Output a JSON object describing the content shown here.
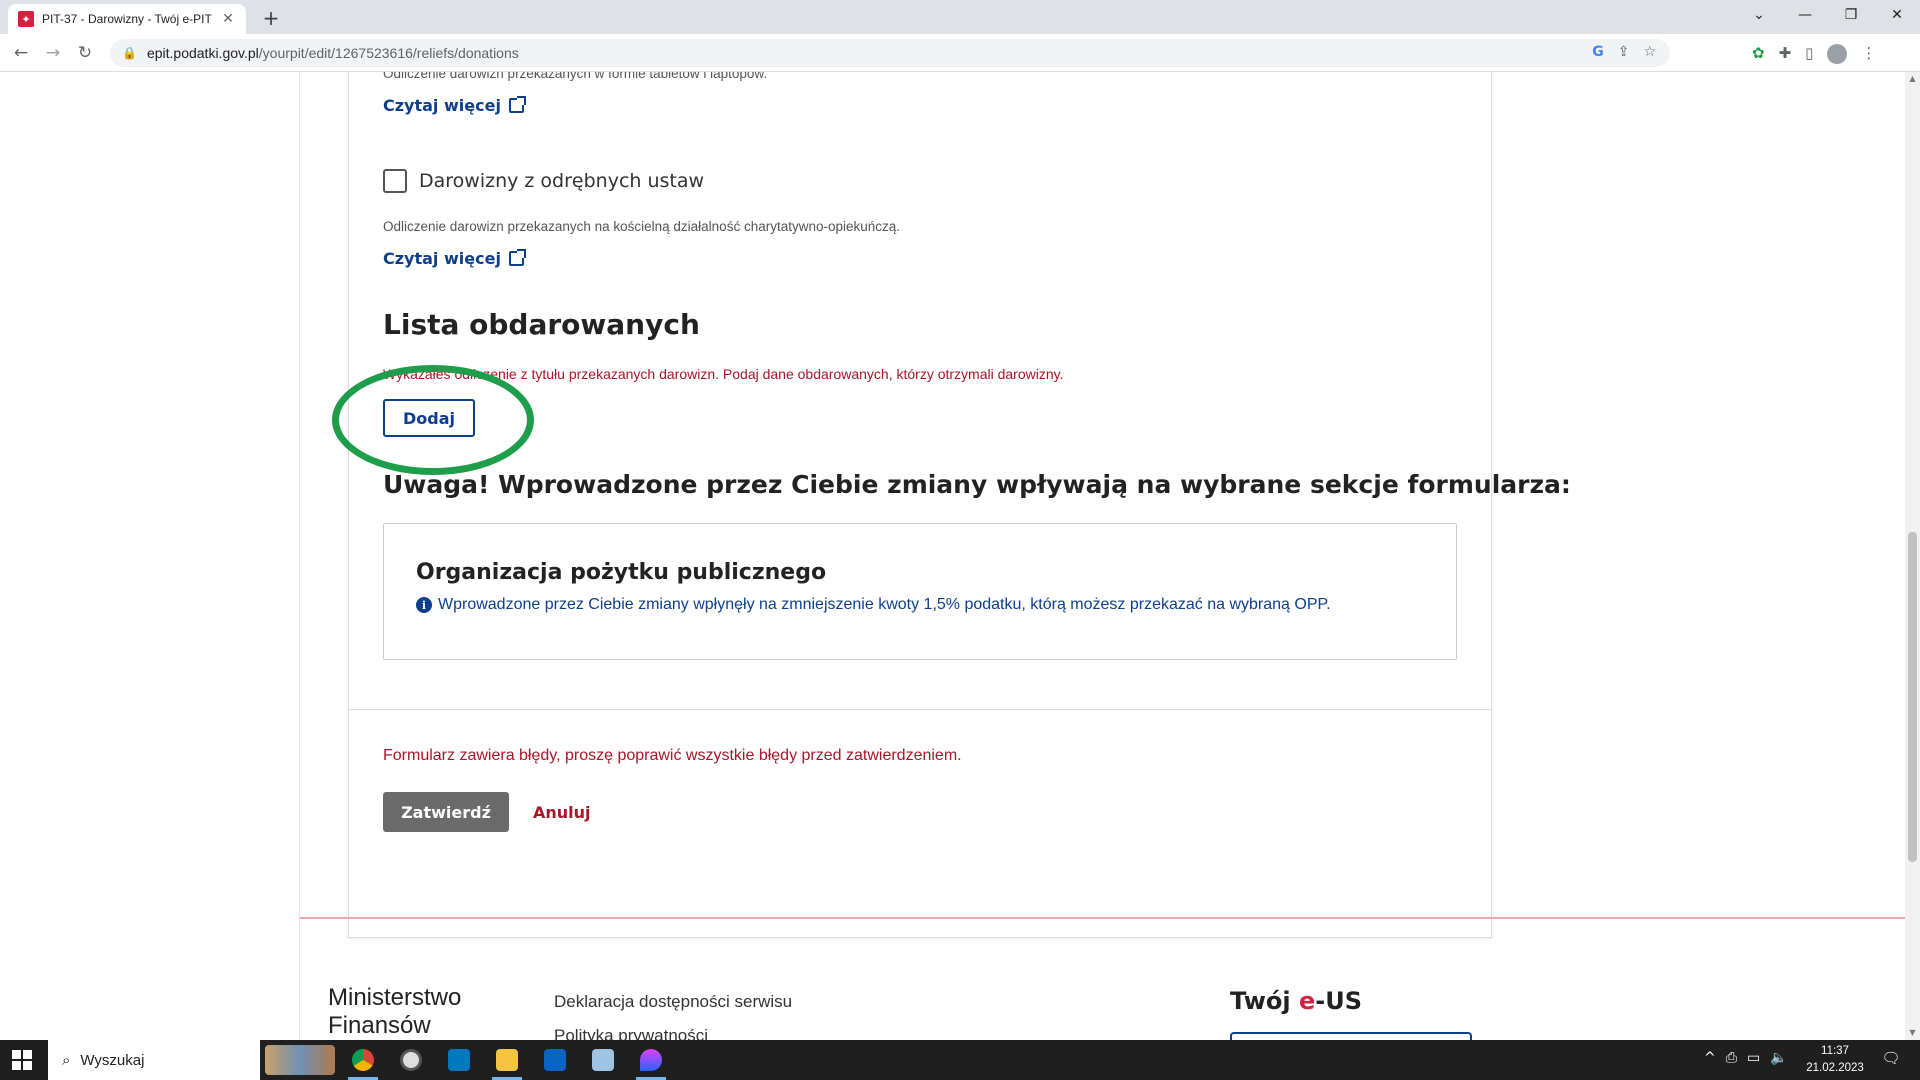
{
  "browser": {
    "tab_title": "PIT-37 - Darowizny - Twój e-PIT",
    "favicon_letter": "🛡",
    "new_tab": "+",
    "url_host": "epit.podatki.gov.pl",
    "url_path": "/yourpit/edit/1267523616/reliefs/donations"
  },
  "page": {
    "prev_description": "Odliczenie darowizn przekazanych w formie tabletów i laptopów.",
    "read_more_1": "Czytaj więcej",
    "checkbox_label": "Darowizny z odrębnych ustaw",
    "checkbox_checked": false,
    "checkbox_description": "Odliczenie darowizn przekazanych na kościelną działalność charytatywno-opiekuńczą.",
    "read_more_2": "Czytaj więcej",
    "recipients_heading": "Lista obdarowanych",
    "recipients_error": "Wykazałeś odliczenie z tytułu przekazanych darowizn. Podaj dane obdarowanych, którzy otrzymali darowizny.",
    "add_button": "Dodaj",
    "warning_heading": "Uwaga! Wprowadzone przez Ciebie zmiany wpływają na wybrane sekcje formularza:",
    "opp_title": "Organizacja pożytku publicznego",
    "opp_info": "Wprowadzone przez Ciebie zmiany wpłynęły na zmniejszenie kwoty 1,5% podatku, którą możesz przekazać na wybraną OPP.",
    "form_error": "Formularz zawiera błędy, proszę poprawić wszystkie błędy przed zatwierdzeniem.",
    "submit_button": "Zatwierdź",
    "cancel_button": "Anuluj"
  },
  "footer": {
    "brand": "Ministerstwo Finansów",
    "link_1": "Deklaracja dostępności serwisu",
    "link_2": "Polityka prywatności",
    "eus_prefix": "Twój ",
    "eus_e": "e",
    "eus_suffix": "-US"
  },
  "taskbar": {
    "search_text": "Wyszukaj",
    "time": "11:37",
    "date": "21.02.2023"
  },
  "colors": {
    "accent": "#0d3f8b",
    "error": "#a8162a",
    "highlight": "#1e9e4b"
  }
}
